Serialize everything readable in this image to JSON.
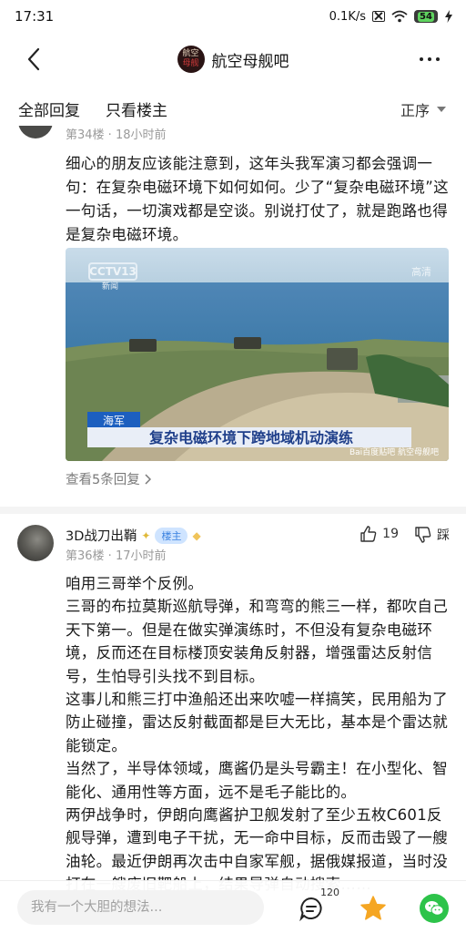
{
  "status_bar": {
    "time": "17:31",
    "network_speed": "0.1K/s",
    "battery": "54"
  },
  "header": {
    "forum_logo_text": [
      "航空",
      "母舰"
    ],
    "forum_name": "航空母舰吧"
  },
  "tabs": {
    "all_replies": "全部回复",
    "only_op": "只看楼主",
    "sort": "正序"
  },
  "prev_post": {
    "meta": "第34楼 · 18小时前",
    "text": "细心的朋友应该能注意到，这年头我军演习都会强调一句：在复杂电磁环境下如何如何。少了“复杂电磁环境”这一句话，一切演戏都是空谈。别说打仗了，就是跑路也得是复杂电磁环境。",
    "image": {
      "cctv_logo": "CCTV13",
      "cctv_sub": "新闻",
      "corner_text": "高清",
      "tag": "海军",
      "caption": "复杂电磁环境下跨地域机动演练",
      "watermark": "Bai百度贴吧 航空母舰吧"
    },
    "view_replies": "查看5条回复"
  },
  "post": {
    "username": "3D战刀出鞘",
    "badge": "楼主",
    "meta": "第36楼 · 17小时前",
    "like_count": "19",
    "dislike_label": "踩",
    "paragraphs": [
      "咱用三哥举个反例。",
      "三哥的布拉莫斯巡航导弹，和弯弯的熊三一样，都吹自己天下第一。但是在做实弹演练时，不但没有复杂电磁环境，反而还在目标楼顶安装角反射器，增强雷达反射信号，生怕导引头找不到目标。",
      "这事儿和熊三打中渔船还出来吹嘘一样搞笑，民用船为了防止碰撞，雷达反射截面都是巨大无比，基本是个雷达就能锁定。",
      "当然了，半导体领域，鹰酱仍是头号霸主！在小型化、智能化、通用性等方面，远不是毛子能比的。",
      "两伊战争时，伊朗向鹰酱护卫舰发射了至少五枚C601反舰导弹，遭到电子干扰，无一命中目标，反而击毁了一艘油轮。最近伊朗再次击中自家军舰，据俄媒报道，当时没打在一艘废旧靶船上，结果导弹自动搜索……"
    ]
  },
  "bottom_bar": {
    "input_placeholder": "我有一个大胆的想法...",
    "comment_count": "120"
  },
  "colors": {
    "accent_blue": "#3b82e0",
    "star_orange": "#f5a623",
    "wechat_green": "#2dc34a",
    "badge_bg": "#cfe4ff"
  }
}
